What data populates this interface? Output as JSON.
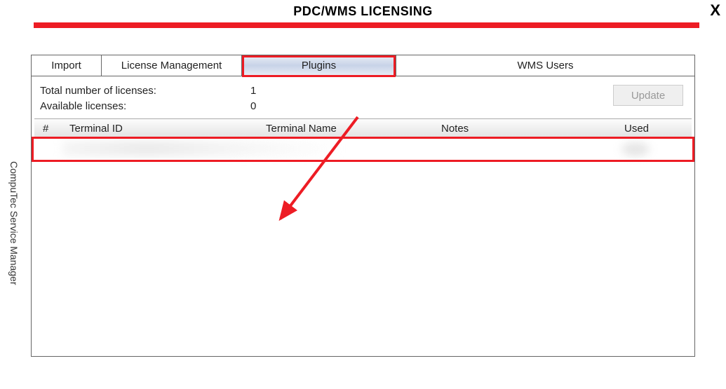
{
  "window": {
    "title": "PDC/WMS LICENSING",
    "close": "X",
    "sidebar_label": "CompuTec Service Manager"
  },
  "tabs": {
    "import": "Import",
    "license": "License Management",
    "plugins": "Plugins",
    "wms": "WMS Users"
  },
  "info": {
    "total_label": "Total number of licenses:",
    "total_value": "1",
    "available_label": "Available licenses:",
    "available_value": "0"
  },
  "buttons": {
    "update": "Update"
  },
  "grid": {
    "headers": {
      "hash": "#",
      "terminal_id": "Terminal ID",
      "terminal_name": "Terminal Name",
      "notes": "Notes",
      "used": "Used"
    }
  }
}
